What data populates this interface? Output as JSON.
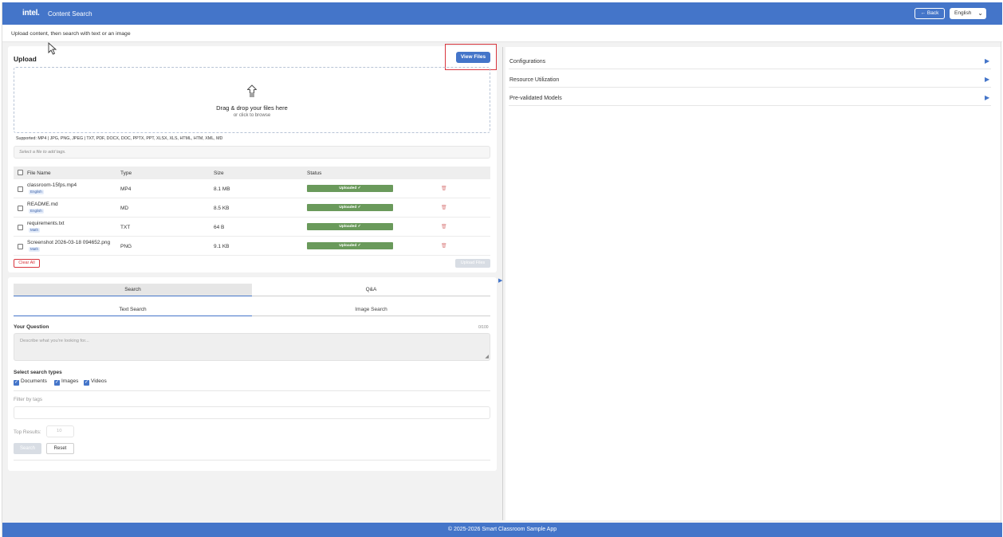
{
  "header": {
    "logo": "intel.",
    "app_title": "Content Search",
    "back_label": "← Back",
    "language": "English"
  },
  "subtitle": "Upload content, then search with text or an image",
  "upload": {
    "title": "Upload",
    "view_files_label": "View Files",
    "drop_main": "Drag & drop your files here",
    "drop_sub": "or click to browse",
    "supported": "Supported: MP4 | JPG, PNG, JPEG | TXT, PDF, DOCX, DOC, PPTX, PPT, XLSX, XLS, HTML, HTM, XML, MD",
    "tags_placeholder": "Select a file to add tags.",
    "columns": [
      "File Name",
      "Type",
      "Size",
      "Status"
    ],
    "files": [
      {
        "name": "classroom-15fps.mp4",
        "tag": "English",
        "type": "MP4",
        "size": "8.1 MB",
        "status": "Uploaded ✓"
      },
      {
        "name": "README.md",
        "tag": "English",
        "type": "MD",
        "size": "8.5 KB",
        "status": "Uploaded ✓"
      },
      {
        "name": "requirements.txt",
        "tag": "Math",
        "type": "TXT",
        "size": "64 B",
        "status": "Uploaded ✓"
      },
      {
        "name": "Screenshot 2026-03-18 094652.png",
        "tag": "Math",
        "type": "PNG",
        "size": "9.1 KB",
        "status": "Uploaded ✓"
      }
    ],
    "clear_all_label": "Clear All",
    "upload_files_label": "Upload Files"
  },
  "search": {
    "tabs": [
      "Search",
      "Q&A"
    ],
    "subtabs": [
      "Text Search",
      "Image Search"
    ],
    "question_label": "Your Question",
    "question_count": "0/100",
    "question_placeholder": "Describe what you're looking for...",
    "types_label": "Select search types",
    "types": [
      "Documents",
      "Images",
      "Videos"
    ],
    "filter_label": "Filter by tags",
    "top_results_label": "Top Results:",
    "top_results_value": "10",
    "search_label": "Search",
    "reset_label": "Reset"
  },
  "right_panel": {
    "items": [
      "Configurations",
      "Resource Utilization",
      "Pre-validated Models"
    ]
  },
  "footer": "© 2025-2026 Smart Classroom Sample App",
  "colors": {
    "brand": "#4475c9",
    "status_ok": "#6a9a5b",
    "danger": "#d9363e"
  }
}
